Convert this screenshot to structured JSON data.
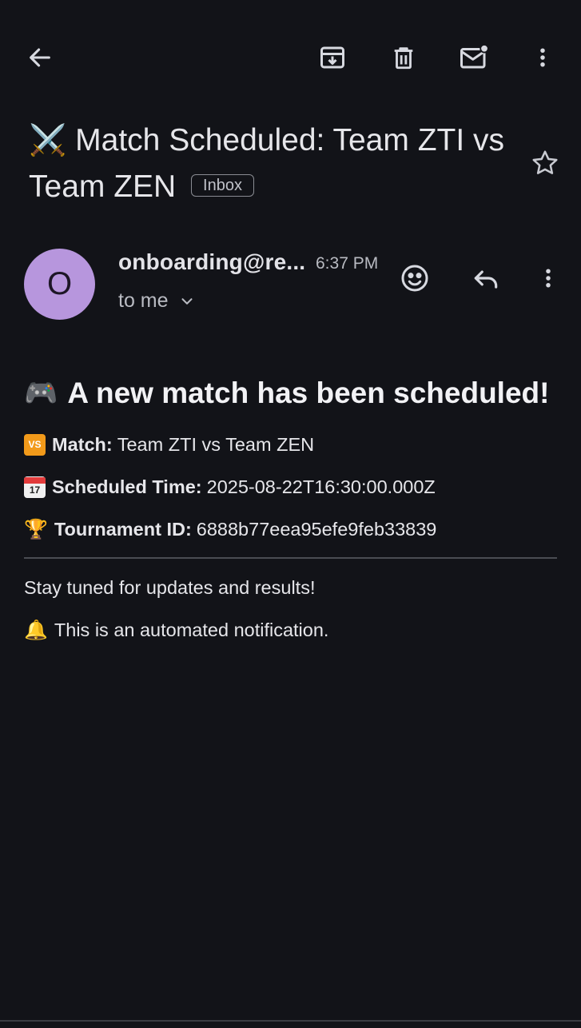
{
  "toolbar": {
    "back_icon": "arrow-left-icon",
    "archive_icon": "archive-icon",
    "delete_icon": "trash-icon",
    "mark_unread_icon": "mail-unread-icon",
    "more_icon": "more-vertical-icon"
  },
  "subject": {
    "emoji": "⚔️",
    "text": "Match Scheduled: Team ZTI vs Team ZEN",
    "label_chip": "Inbox",
    "starred": false
  },
  "message_header": {
    "avatar_letter": "O",
    "avatar_color": "#b796dd",
    "sender": "onboarding@re...",
    "time": "6:37 PM",
    "recipient": "to me"
  },
  "body": {
    "headline_emoji": "🎮",
    "headline": "A new match has been scheduled!",
    "match_label": "Match:",
    "match_value": "Team ZTI vs Team ZEN",
    "vs_badge": "VS",
    "scheduled_label": "Scheduled Time:",
    "scheduled_value": "2025-08-22T16:30:00.000Z",
    "calendar_day": "17",
    "tournament_label": "Tournament ID:",
    "tournament_value": "6888b77eea95efe9feb33839",
    "trophy_glyph": "🏆",
    "footer_line_1": "Stay tuned for updates and results!",
    "bell_glyph": "🔔",
    "footer_line_2": "This is an automated notification."
  },
  "colors": {
    "background": "#121318",
    "avatar": "#b796dd",
    "vs_badge": "#f29a1a"
  }
}
